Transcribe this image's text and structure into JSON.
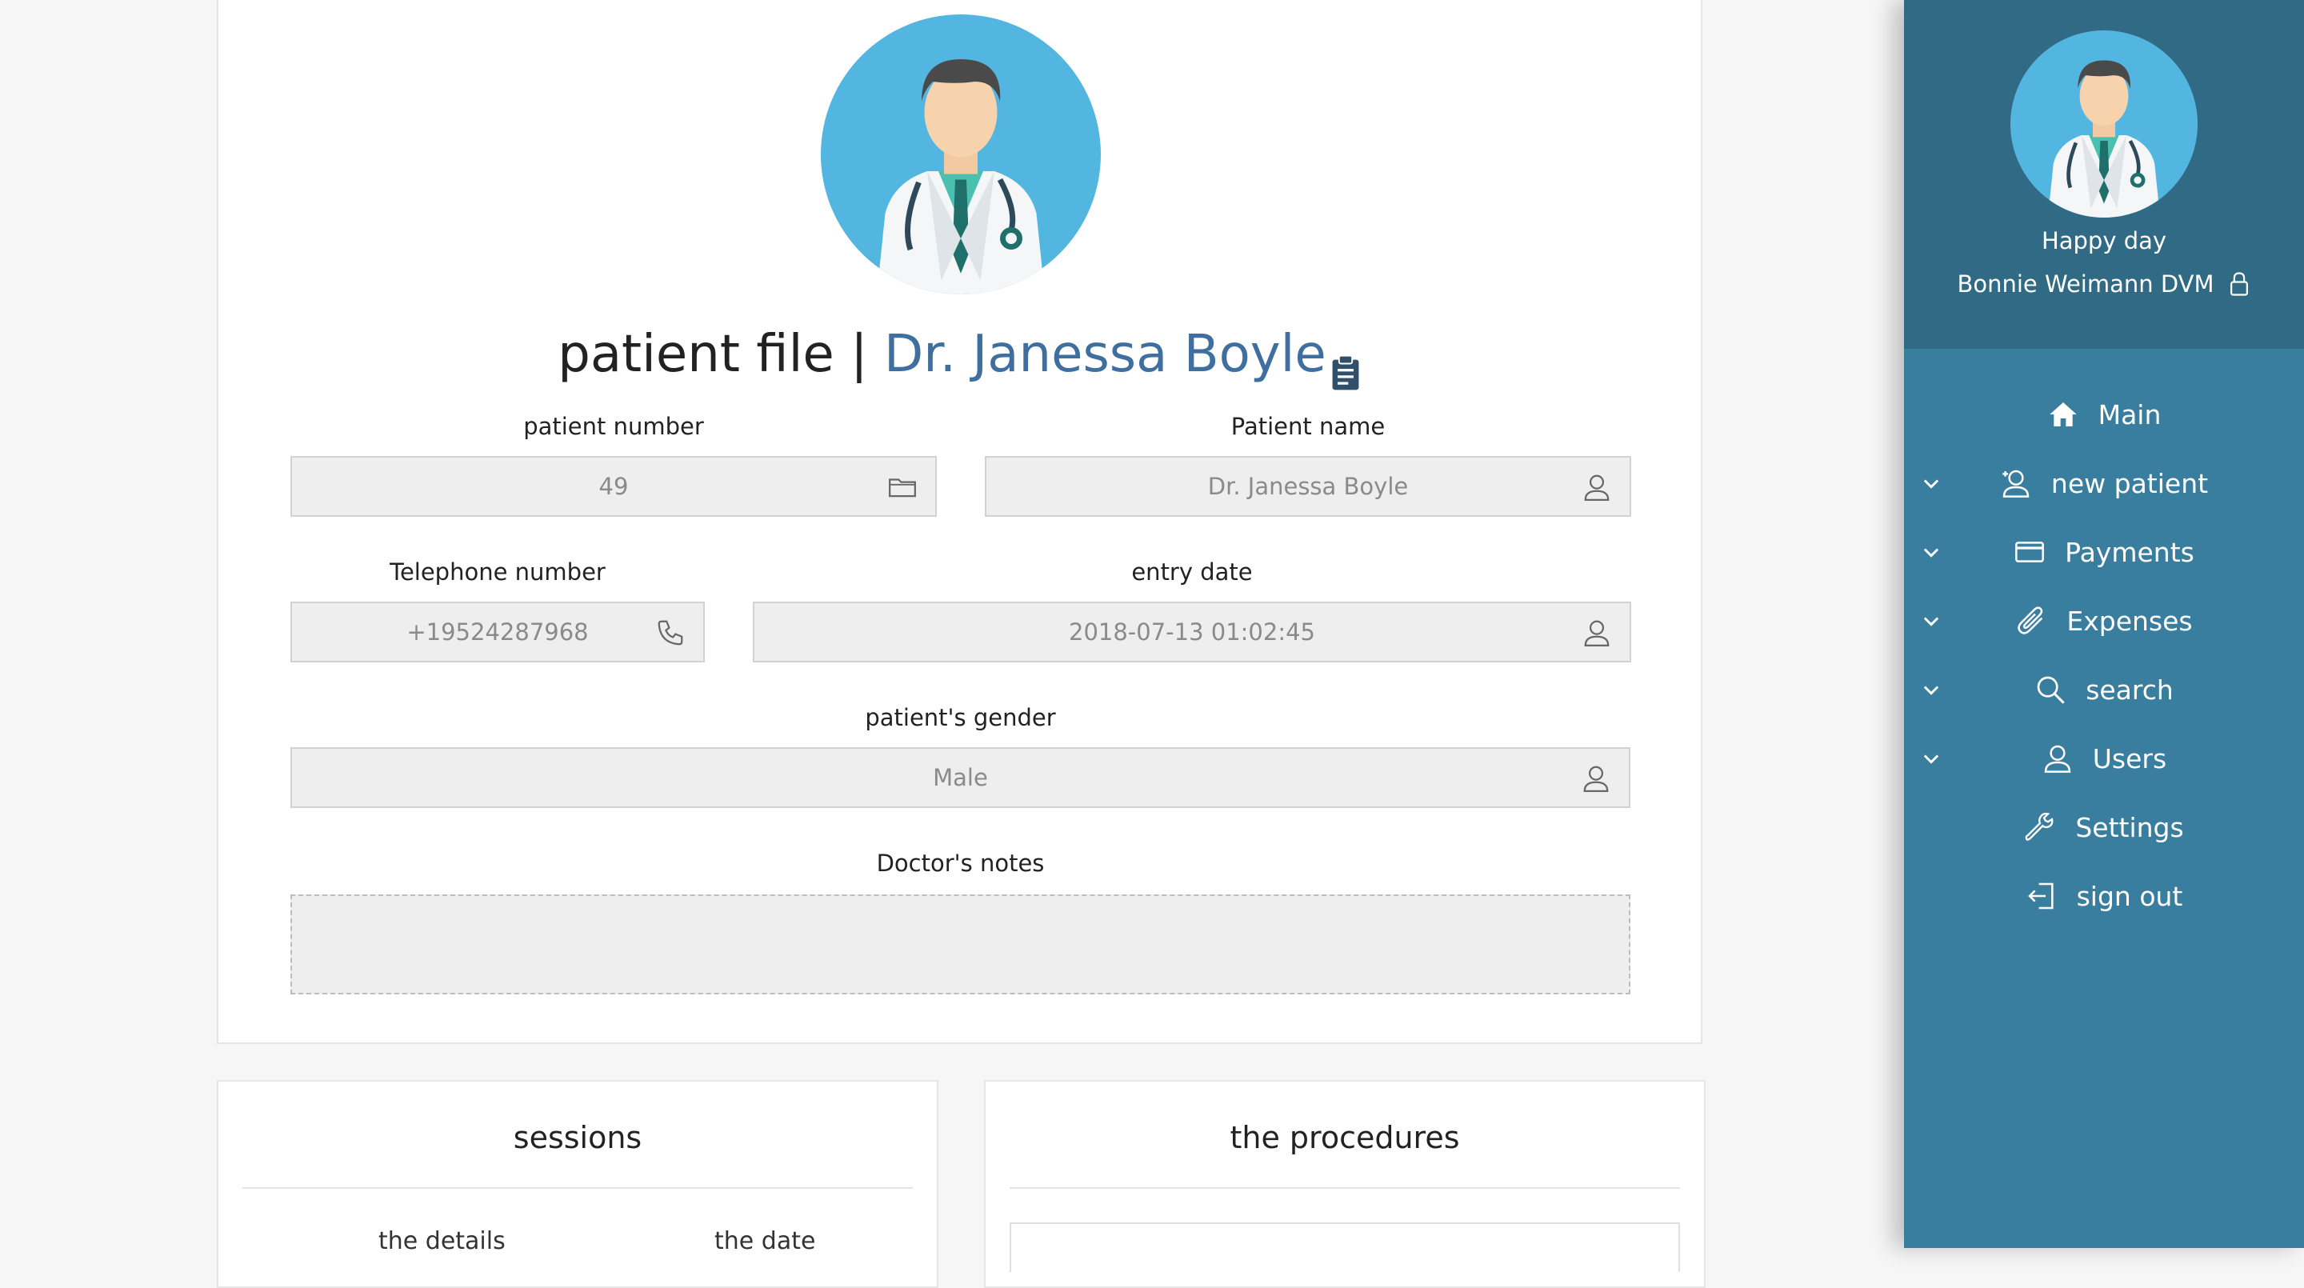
{
  "patient_card": {
    "title_prefix": "patient file | ",
    "title_name": "Dr. Janessa Boyle",
    "fields": {
      "patient_number": {
        "label": "patient number",
        "value": "49"
      },
      "patient_name": {
        "label": "Patient name",
        "value": "Dr. Janessa Boyle"
      },
      "telephone": {
        "label": "Telephone number",
        "value": "+19524287968"
      },
      "entry_date": {
        "label": "entry date",
        "value": "2018-07-13 01:02:45"
      },
      "gender": {
        "label": "patient's gender",
        "value": "Male"
      },
      "notes": {
        "label": "Doctor's notes",
        "value": ""
      }
    }
  },
  "sessions": {
    "title": "sessions",
    "columns": [
      "the details",
      "the date"
    ]
  },
  "procedures": {
    "title": "the procedures"
  },
  "sidebar": {
    "greeting": "Happy day",
    "user_name": "Bonnie Weimann DVM",
    "items": [
      {
        "label": "Main",
        "icon": "home-icon",
        "expandable": false
      },
      {
        "label": "new patient",
        "icon": "add-user-icon",
        "expandable": true
      },
      {
        "label": "Payments",
        "icon": "credit-card-icon",
        "expandable": true
      },
      {
        "label": "Expenses",
        "icon": "paperclip-icon",
        "expandable": true
      },
      {
        "label": "search",
        "icon": "search-icon",
        "expandable": true
      },
      {
        "label": "Users",
        "icon": "user-icon",
        "expandable": true
      },
      {
        "label": "Settings",
        "icon": "wrench-icon",
        "expandable": false
      },
      {
        "label": "sign out",
        "icon": "sign-out-icon",
        "expandable": false
      }
    ]
  },
  "colors": {
    "sidebar_bg": "#3a7e9f",
    "sidebar_header_bg": "#306a84",
    "accent_name": "#3f6f9e",
    "avatar_bg": "#52b6e0"
  }
}
